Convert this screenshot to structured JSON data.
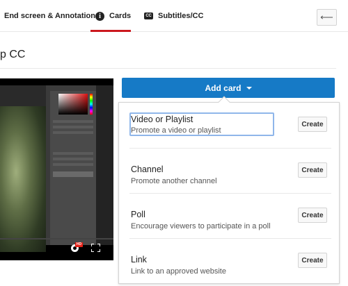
{
  "tabs": [
    {
      "label": "End screen & Annotations"
    },
    {
      "label": "Cards",
      "icon": "info-icon",
      "active": true
    },
    {
      "label": "Subtitles/CC",
      "icon": "cc-icon"
    }
  ],
  "tabs_icons": {
    "cards_glyph": "i",
    "cc_glyph": "CC"
  },
  "back_button": {
    "icon": "back-arrow-icon",
    "glyph": "⟵"
  },
  "page": {
    "title": "p CC"
  },
  "video": {
    "hd_badge": "HD",
    "progress": 0
  },
  "add_card": {
    "label": "Add card"
  },
  "options": [
    {
      "title": "Video or Playlist",
      "description": "Promote a video or playlist",
      "button": "Create"
    },
    {
      "title": "Channel",
      "description": "Promote another channel",
      "button": "Create"
    },
    {
      "title": "Poll",
      "description": "Encourage viewers to participate in a poll",
      "button": "Create"
    },
    {
      "title": "Link",
      "description": "Link to an approved website",
      "button": "Create"
    }
  ],
  "colors": {
    "accent": "#167ac6",
    "active_tab": "#cc181e",
    "hd_badge": "#e62117"
  }
}
